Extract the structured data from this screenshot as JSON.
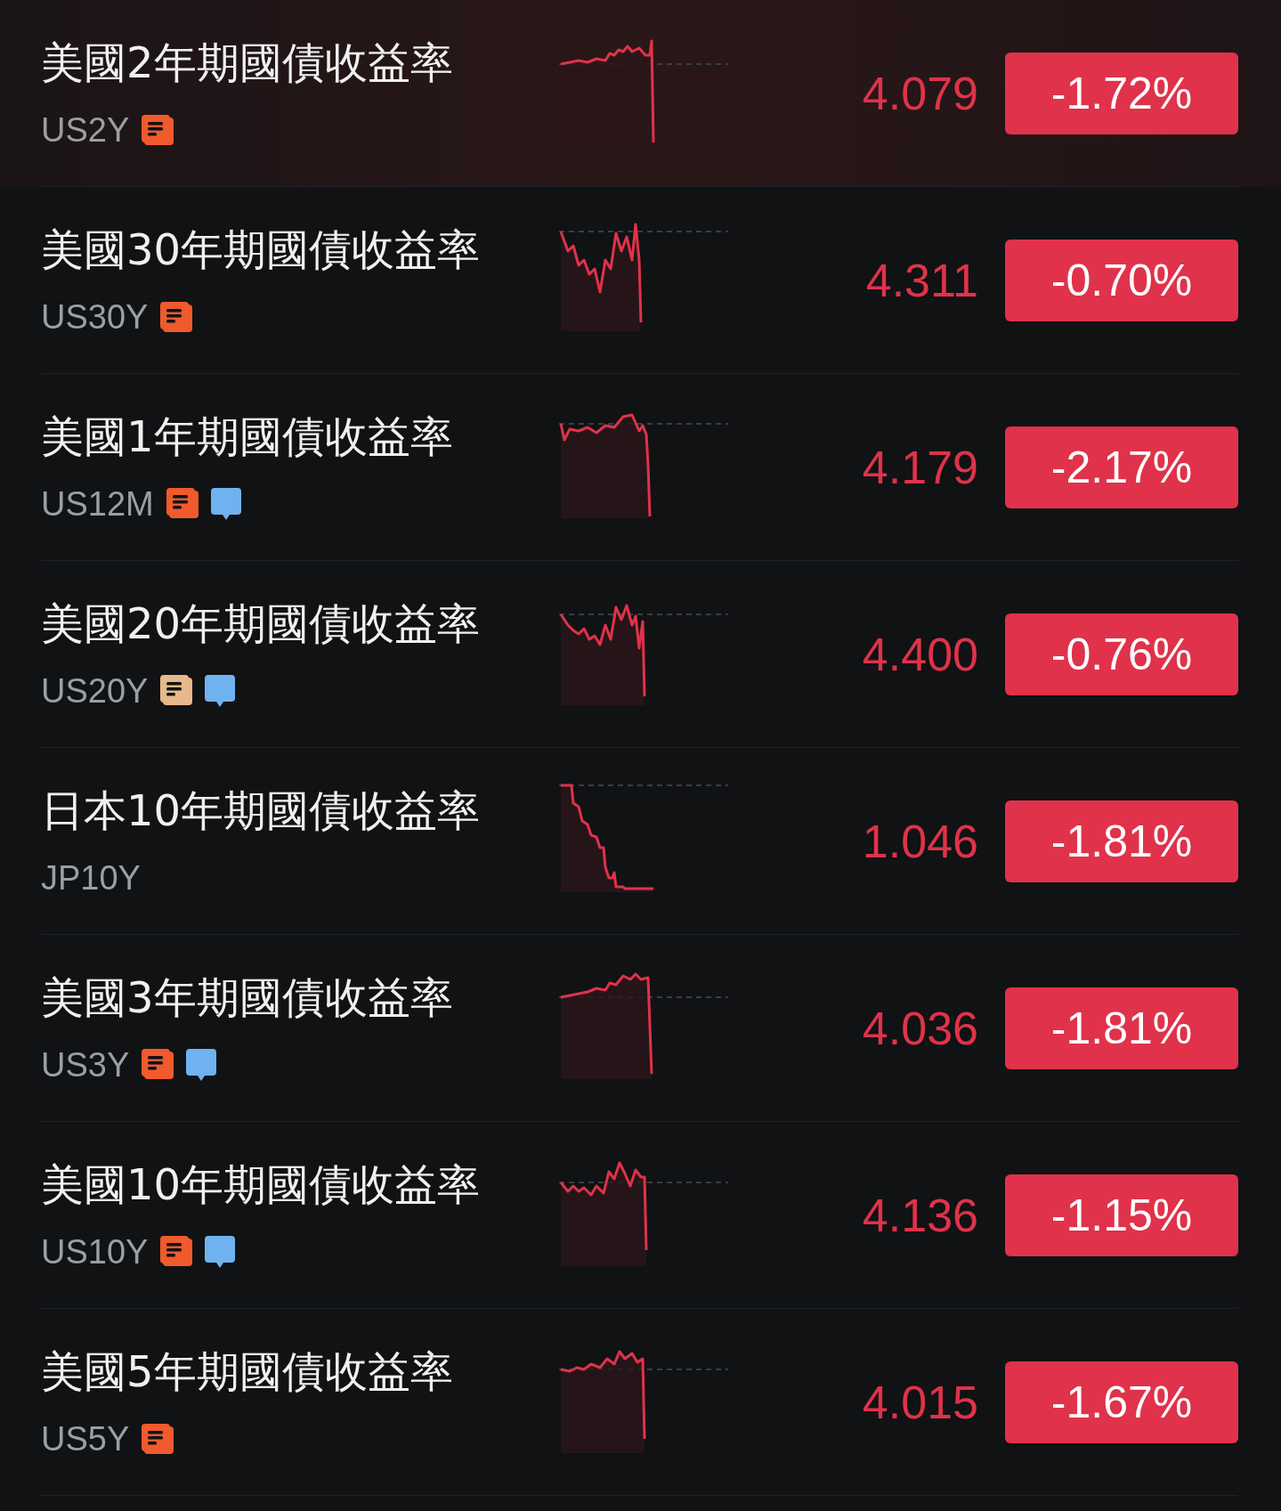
{
  "quotes": [
    {
      "name": "美國2年期國債收益率",
      "ticker": "US2Y",
      "price": "4.079",
      "change": "-1.72%",
      "selected": true,
      "badges": [
        {
          "kind": "news",
          "color": "#f05a2c"
        }
      ]
    },
    {
      "name": "美國30年期國債收益率",
      "ticker": "US30Y",
      "price": "4.311",
      "change": "-0.70%",
      "selected": false,
      "badges": [
        {
          "kind": "news",
          "color": "#f05a2c"
        }
      ]
    },
    {
      "name": "美國1年期國債收益率",
      "ticker": "US12M",
      "price": "4.179",
      "change": "-2.17%",
      "selected": false,
      "badges": [
        {
          "kind": "news",
          "color": "#f05a2c"
        },
        {
          "kind": "comment",
          "color": "#6fb2f0"
        }
      ]
    },
    {
      "name": "美國20年期國債收益率",
      "ticker": "US20Y",
      "price": "4.400",
      "change": "-0.76%",
      "selected": false,
      "badges": [
        {
          "kind": "news",
          "color": "#e6b88a"
        },
        {
          "kind": "comment",
          "color": "#6fb2f0"
        }
      ]
    },
    {
      "name": "日本10年期國債收益率",
      "ticker": "JP10Y",
      "price": "1.046",
      "change": "-1.81%",
      "selected": false
    },
    {
      "name": "美國3年期國債收益率",
      "ticker": "US3Y",
      "price": "4.036",
      "change": "-1.81%",
      "selected": false,
      "badges": [
        {
          "kind": "news",
          "color": "#f05a2c"
        },
        {
          "kind": "comment",
          "color": "#6fb2f0"
        }
      ]
    },
    {
      "name": "美國10年期國債收益率",
      "ticker": "US10Y",
      "price": "4.136",
      "change": "-1.15%",
      "selected": false,
      "badges": [
        {
          "kind": "news",
          "color": "#f05a2c"
        },
        {
          "kind": "comment",
          "color": "#6fb2f0"
        }
      ]
    },
    {
      "name": "美國5年期國債收益率",
      "ticker": "US5Y",
      "price": "4.015",
      "change": "-1.67%",
      "selected": false,
      "badges": [
        {
          "kind": "news",
          "color": "#f05a2c"
        }
      ]
    }
  ]
}
